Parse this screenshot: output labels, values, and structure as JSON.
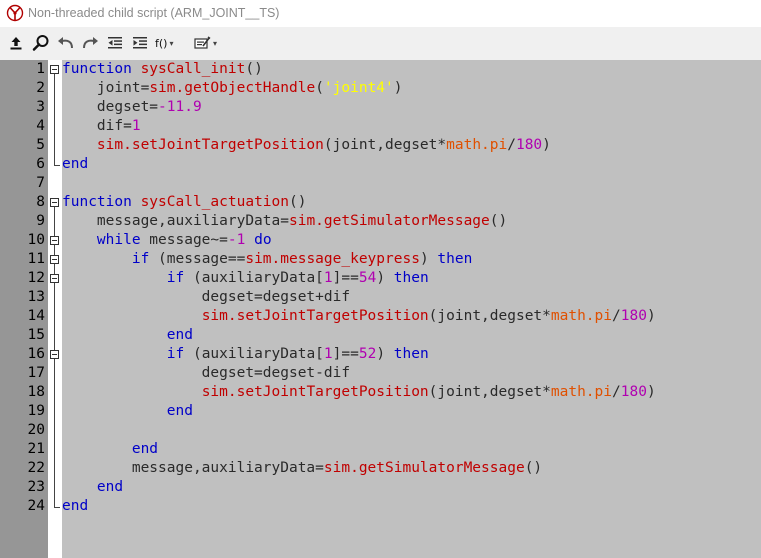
{
  "window": {
    "title": "Non-threaded child script (ARM_JOINT__TS)"
  },
  "toolbar": {
    "items": [
      {
        "name": "upload-icon"
      },
      {
        "name": "search-icon"
      },
      {
        "name": "undo-icon"
      },
      {
        "name": "redo-icon"
      },
      {
        "name": "outdent-icon"
      },
      {
        "name": "indent-icon"
      },
      {
        "name": "function-dropdown",
        "label": "f()"
      },
      {
        "name": "snippet-dropdown"
      }
    ],
    "function_label": "f()",
    "caret": "▾"
  },
  "editor": {
    "line_numbers": [
      "1",
      "2",
      "3",
      "4",
      "5",
      "6",
      "7",
      "8",
      "9",
      "10",
      "11",
      "12",
      "13",
      "14",
      "15",
      "16",
      "17",
      "18",
      "19",
      "20",
      "21",
      "22",
      "23",
      "24"
    ],
    "lines": [
      [
        [
          "kw",
          "function "
        ],
        [
          "fn",
          "sysCall_init"
        ],
        [
          "op",
          "()"
        ]
      ],
      [
        [
          "op",
          "    joint="
        ],
        [
          "fn",
          "sim.getObjectHandle"
        ],
        [
          "op",
          "("
        ],
        [
          "str",
          "'joint4'"
        ],
        [
          "op",
          ")"
        ]
      ],
      [
        [
          "op",
          "    degset="
        ],
        [
          "num",
          "-11.9"
        ]
      ],
      [
        [
          "op",
          "    dif="
        ],
        [
          "num",
          "1"
        ]
      ],
      [
        [
          "op",
          "    "
        ],
        [
          "fn",
          "sim.setJointTargetPosition"
        ],
        [
          "op",
          "(joint,degset*"
        ],
        [
          "mth",
          "math.pi"
        ],
        [
          "op",
          "/"
        ],
        [
          "num",
          "180"
        ],
        [
          "op",
          ")"
        ]
      ],
      [
        [
          "kw",
          "end"
        ]
      ],
      [],
      [
        [
          "kw",
          "function "
        ],
        [
          "fn",
          "sysCall_actuation"
        ],
        [
          "op",
          "()"
        ]
      ],
      [
        [
          "op",
          "    message,auxiliaryData="
        ],
        [
          "fn",
          "sim.getSimulatorMessage"
        ],
        [
          "op",
          "()"
        ]
      ],
      [
        [
          "op",
          "    "
        ],
        [
          "kw",
          "while"
        ],
        [
          "op",
          " message~="
        ],
        [
          "num",
          "-1"
        ],
        [
          "op",
          " "
        ],
        [
          "kw",
          "do"
        ]
      ],
      [
        [
          "op",
          "        "
        ],
        [
          "kw",
          "if"
        ],
        [
          "op",
          " (message=="
        ],
        [
          "fn",
          "sim.message_keypress"
        ],
        [
          "op",
          ") "
        ],
        [
          "kw",
          "then"
        ]
      ],
      [
        [
          "op",
          "            "
        ],
        [
          "kw",
          "if"
        ],
        [
          "op",
          " (auxiliaryData["
        ],
        [
          "num",
          "1"
        ],
        [
          "op",
          "]=="
        ],
        [
          "num",
          "54"
        ],
        [
          "op",
          ") "
        ],
        [
          "kw",
          "then"
        ]
      ],
      [
        [
          "op",
          "                degset=degset+dif"
        ]
      ],
      [
        [
          "op",
          "                "
        ],
        [
          "fn",
          "sim.setJointTargetPosition"
        ],
        [
          "op",
          "(joint,degset*"
        ],
        [
          "mth",
          "math.pi"
        ],
        [
          "op",
          "/"
        ],
        [
          "num",
          "180"
        ],
        [
          "op",
          ")"
        ]
      ],
      [
        [
          "op",
          "            "
        ],
        [
          "kw",
          "end"
        ]
      ],
      [
        [
          "op",
          "            "
        ],
        [
          "kw",
          "if"
        ],
        [
          "op",
          " (auxiliaryData["
        ],
        [
          "num",
          "1"
        ],
        [
          "op",
          "]=="
        ],
        [
          "num",
          "52"
        ],
        [
          "op",
          ") "
        ],
        [
          "kw",
          "then"
        ]
      ],
      [
        [
          "op",
          "                degset=degset-dif"
        ]
      ],
      [
        [
          "op",
          "                "
        ],
        [
          "fn",
          "sim.setJointTargetPosition"
        ],
        [
          "op",
          "(joint,degset*"
        ],
        [
          "mth",
          "math.pi"
        ],
        [
          "op",
          "/"
        ],
        [
          "num",
          "180"
        ],
        [
          "op",
          ")"
        ]
      ],
      [
        [
          "op",
          "            "
        ],
        [
          "kw",
          "end"
        ]
      ],
      [],
      [
        [
          "op",
          "        "
        ],
        [
          "kw",
          "end"
        ]
      ],
      [
        [
          "op",
          "        message,auxiliaryData="
        ],
        [
          "fn",
          "sim.getSimulatorMessage"
        ],
        [
          "op",
          "()"
        ]
      ],
      [
        [
          "op",
          "    "
        ],
        [
          "kw",
          "end"
        ]
      ],
      [
        [
          "kw",
          "end"
        ]
      ]
    ],
    "folds": [
      {
        "line": 1,
        "type": "box"
      },
      {
        "line": 6,
        "type": "end"
      },
      {
        "line": 8,
        "type": "box"
      },
      {
        "line": 10,
        "type": "box"
      },
      {
        "line": 11,
        "type": "box"
      },
      {
        "line": 12,
        "type": "box"
      },
      {
        "line": 16,
        "type": "box"
      },
      {
        "line": 24,
        "type": "end"
      }
    ]
  },
  "colors": {
    "keyword": "#0000c8",
    "function": "#c00000",
    "number": "#b000b0",
    "string": "#ffff00",
    "math": "#e05000",
    "text": "#2a2a2a",
    "editor_bg": "#c0c0c0",
    "gutter_bg": "#969696"
  }
}
